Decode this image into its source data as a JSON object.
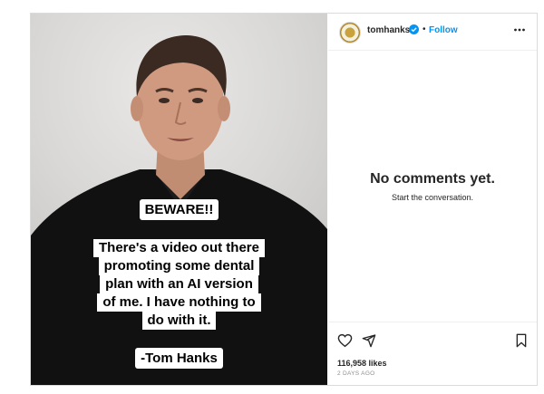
{
  "post": {
    "overlay": {
      "beware": "BEWARE!!",
      "message_lines": [
        "There's a video out there",
        "promoting some dental",
        "plan with an AI version",
        "of me.  I have nothing to",
        "do with it."
      ],
      "signature": "-Tom Hanks"
    }
  },
  "sidebar": {
    "username": "tomhanks",
    "separator": "•",
    "follow_label": "Follow",
    "no_comments": "No comments yet.",
    "start_conversation": "Start the conversation.",
    "likes": "116,958 likes",
    "posted": "2 DAYS AGO"
  },
  "icons": {
    "verified": "verified-badge-icon",
    "more": "more-options-icon",
    "like": "heart-icon",
    "share": "share-icon",
    "save": "bookmark-icon"
  },
  "colors": {
    "link": "#0095f6",
    "verified": "#0095f6",
    "text": "#262626",
    "muted": "#8e8e8e"
  }
}
